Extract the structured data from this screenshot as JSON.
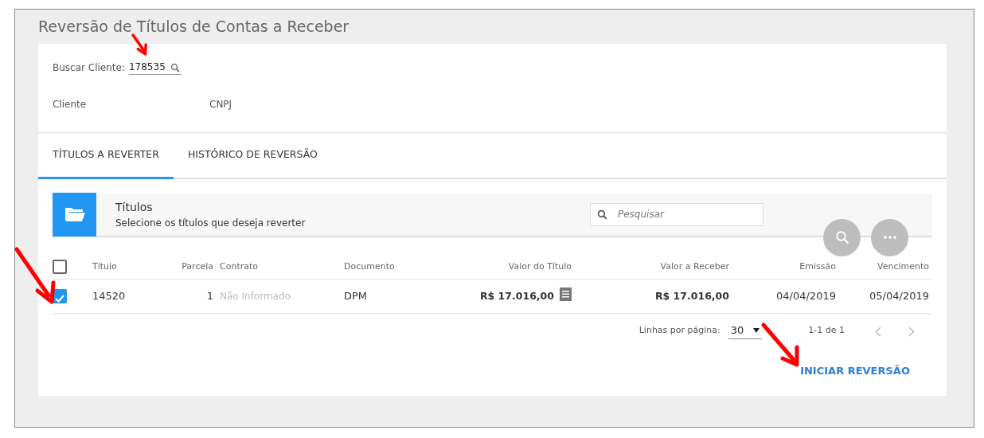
{
  "page": {
    "title": "Reversão de Títulos de Contas a Receber"
  },
  "customer": {
    "search_label": "Buscar Cliente:",
    "search_value": "178535",
    "fields": [
      {
        "label": "Cliente"
      },
      {
        "label": "CNPJ"
      }
    ]
  },
  "tabs": [
    {
      "label": "TÍTULOS A REVERTER",
      "selected": true
    },
    {
      "label": "HISTÓRICO DE REVERSÃO",
      "selected": false
    }
  ],
  "panel": {
    "title": "Títulos",
    "subtitle": "Selecione os títulos que deseja reverter",
    "search": {
      "placeholder": "Pesquisar"
    }
  },
  "table": {
    "select_all_checked": false,
    "columns": [
      "Título",
      "Parcela",
      "Contrato",
      "Documento",
      "Valor do Título",
      "Valor a Receber",
      "Emissão",
      "Vencimento"
    ],
    "rows": [
      {
        "checked": true,
        "cells": [
          "14520",
          "1",
          "Não Informado",
          "DPM",
          "R$ 17.016,00",
          "R$ 17.016,00",
          "04/04/2019",
          "05/04/2019"
        ]
      }
    ]
  },
  "pagination": {
    "label": "Linhas por página:",
    "rows_per_page": "30",
    "range": "1-1 de 1"
  },
  "actions": [
    {
      "label": "INICIAR REVERSÃO"
    }
  ]
}
